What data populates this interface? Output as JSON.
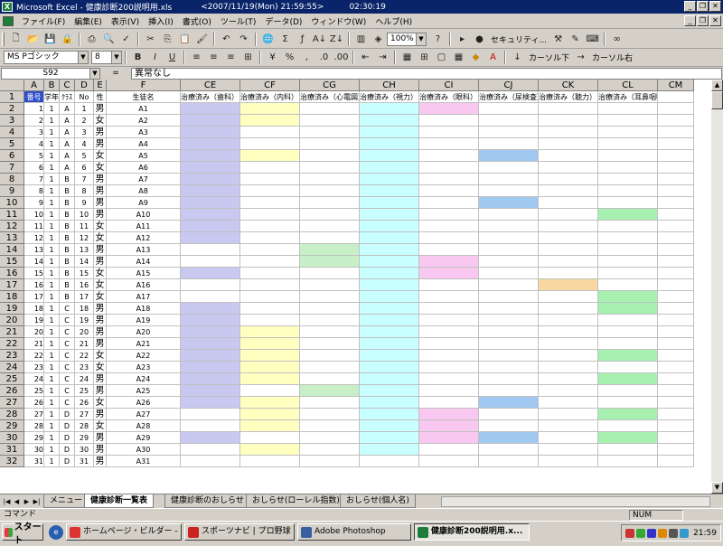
{
  "window": {
    "title": "Microsoft Excel - 健康診断200説明用.xls",
    "meta": "<2007/11/19(Mon) 21:59:55>",
    "clock": "02:30:19",
    "icon": "excel-icon"
  },
  "menu": [
    "ファイル(F)",
    "編集(E)",
    "表示(V)",
    "挿入(I)",
    "書式(O)",
    "ツール(T)",
    "データ(D)",
    "ウィンドウ(W)",
    "ヘルプ(H)"
  ],
  "toolbar1": {
    "zoom": "100%",
    "security_label": "セキュリティ...",
    "buttons": [
      "new-icon",
      "open-icon",
      "save-icon",
      "permission-icon",
      "print-icon",
      "preview-icon",
      "spell-icon",
      "cut-icon",
      "copy-icon",
      "paste-icon",
      "format-painter-icon",
      "undo-icon",
      "redo-icon",
      "hyperlink-icon",
      "autosum-icon",
      "function-icon",
      "sort-asc-icon",
      "sort-desc-icon",
      "chart-icon",
      "drawing-icon",
      "help-icon"
    ]
  },
  "toolbar2": {
    "font": "MS Pゴシック",
    "size": "8",
    "bold": "B",
    "italic": "I",
    "underline": "U",
    "percent": "%",
    "comma": ",",
    "cursor_down": "カーソル下",
    "cursor_right": "カーソル右"
  },
  "formula": {
    "name_box": "S92",
    "eq": "=",
    "value": "異常なし"
  },
  "grid": {
    "columns": [
      "A",
      "B",
      "C",
      "D",
      "E",
      "F",
      "CE",
      "CF",
      "CG",
      "CH",
      "CI",
      "CJ",
      "CK",
      "CL",
      "CM"
    ],
    "header_row": [
      "番号",
      "学年",
      "ｸﾗｽ",
      "No",
      "性",
      "生徒名",
      "治療済み（歯科）",
      "治療済み（内科）",
      "治療済み（心電図）",
      "治療済み（視力）",
      "治療済み（眼科）",
      "治療済み（尿検査）",
      "治療済み（聴力）",
      "治療済み（耳鼻咽喉）",
      ""
    ],
    "rows": [
      [
        "1",
        "1",
        "A",
        "1",
        "男",
        "A1"
      ],
      [
        "2",
        "1",
        "A",
        "2",
        "女",
        "A2"
      ],
      [
        "3",
        "1",
        "A",
        "3",
        "男",
        "A3"
      ],
      [
        "4",
        "1",
        "A",
        "4",
        "男",
        "A4"
      ],
      [
        "5",
        "1",
        "A",
        "5",
        "女",
        "A5"
      ],
      [
        "6",
        "1",
        "A",
        "6",
        "女",
        "A6"
      ],
      [
        "7",
        "1",
        "B",
        "7",
        "男",
        "A7"
      ],
      [
        "8",
        "1",
        "B",
        "8",
        "男",
        "A8"
      ],
      [
        "9",
        "1",
        "B",
        "9",
        "男",
        "A9"
      ],
      [
        "10",
        "1",
        "B",
        "10",
        "男",
        "A10"
      ],
      [
        "11",
        "1",
        "B",
        "11",
        "女",
        "A11"
      ],
      [
        "12",
        "1",
        "B",
        "12",
        "女",
        "A12"
      ],
      [
        "13",
        "1",
        "B",
        "13",
        "男",
        "A13"
      ],
      [
        "14",
        "1",
        "B",
        "14",
        "男",
        "A14"
      ],
      [
        "15",
        "1",
        "B",
        "15",
        "女",
        "A15"
      ],
      [
        "16",
        "1",
        "B",
        "16",
        "女",
        "A16"
      ],
      [
        "17",
        "1",
        "B",
        "17",
        "女",
        "A17"
      ],
      [
        "18",
        "1",
        "C",
        "18",
        "男",
        "A18"
      ],
      [
        "19",
        "1",
        "C",
        "19",
        "男",
        "A19"
      ],
      [
        "20",
        "1",
        "C",
        "20",
        "男",
        "A20"
      ],
      [
        "21",
        "1",
        "C",
        "21",
        "男",
        "A21"
      ],
      [
        "22",
        "1",
        "C",
        "22",
        "女",
        "A22"
      ],
      [
        "23",
        "1",
        "C",
        "23",
        "女",
        "A23"
      ],
      [
        "24",
        "1",
        "C",
        "24",
        "男",
        "A24"
      ],
      [
        "25",
        "1",
        "C",
        "25",
        "男",
        "A25"
      ],
      [
        "26",
        "1",
        "C",
        "26",
        "女",
        "A26"
      ],
      [
        "27",
        "1",
        "D",
        "27",
        "男",
        "A27"
      ],
      [
        "28",
        "1",
        "D",
        "28",
        "女",
        "A28"
      ],
      [
        "29",
        "1",
        "D",
        "29",
        "男",
        "A29"
      ],
      [
        "30",
        "1",
        "D",
        "30",
        "男",
        "A30"
      ],
      [
        "31",
        "1",
        "D",
        "31",
        "男",
        "A31"
      ]
    ],
    "fills": {
      "CE": [
        1,
        2,
        3,
        4,
        5,
        6,
        7,
        8,
        9,
        10,
        11,
        12,
        15,
        18,
        19,
        20,
        21,
        22,
        23,
        24,
        25,
        26,
        29
      ],
      "CF": [
        1,
        2,
        5,
        20,
        21,
        22,
        23,
        24,
        26,
        27,
        28,
        30
      ],
      "CG": [
        13,
        14,
        25
      ],
      "CH": [
        1,
        2,
        3,
        4,
        5,
        6,
        7,
        8,
        9,
        10,
        11,
        12,
        13,
        14,
        15,
        16,
        17,
        18,
        19,
        20,
        21,
        22,
        23,
        24,
        25,
        26,
        27,
        28,
        29,
        30
      ],
      "CI": [
        1,
        14,
        15,
        27,
        28,
        29
      ],
      "CJ": [
        5,
        9,
        26,
        29
      ],
      "CK": [
        16
      ],
      "CL": [
        10,
        17,
        18,
        22,
        24,
        27,
        29
      ]
    },
    "fill_colors": {
      "CE": "#c8c8f0",
      "CF": "#ffffc0",
      "CG": "#c8f0c8",
      "CH": "#c8ffff",
      "CI": "#f8c8f0",
      "CJ": "#a0c8f0",
      "CK": "#f8d8a0",
      "CL": "#a8f0b0"
    }
  },
  "sheets": [
    "メニュー",
    "健康診断一覧表",
    "健康診断のおしらせ",
    "おしらせ(ローレル指数)",
    "おしらせ(個人名)"
  ],
  "active_sheet": 1,
  "status": {
    "left": "コマンド",
    "num": "NUM"
  },
  "taskbar": {
    "start": "スタート",
    "tasks": [
      {
        "label": "ホームページ・ビルダー - [...",
        "icon": "homepage-builder-icon",
        "color": "#d33"
      },
      {
        "label": "スポーツナビ | プロ野球 | ...",
        "icon": "browser-icon",
        "color": "#c22"
      },
      {
        "label": "Adobe Photoshop",
        "icon": "photoshop-icon",
        "color": "#3a5fa0"
      },
      {
        "label": "健康診断200説明用.x...",
        "icon": "excel-icon",
        "color": "#1d7d3a"
      }
    ],
    "clock": "21:59"
  }
}
